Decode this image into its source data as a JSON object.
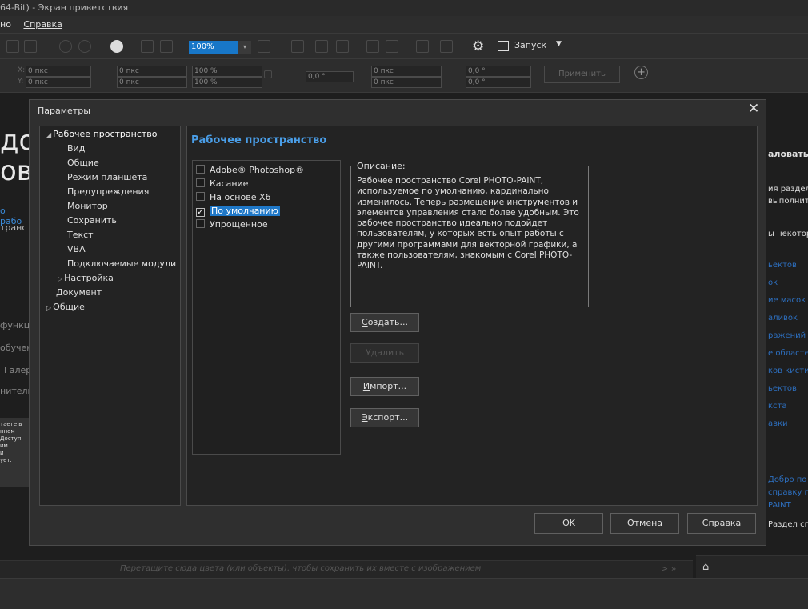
{
  "window": {
    "title": "64-Bit) - Экран приветствия"
  },
  "menu": {
    "items": [
      "но",
      "Справка"
    ]
  },
  "toolbar": {
    "zoom_value": "100%",
    "launch_label": "Запуск",
    "apply_label": "Применить",
    "fields": {
      "x_label": "X:",
      "x_value": "0 пкс",
      "y_label": "Y:",
      "y_value": "0 пкс",
      "w_value": "0 пкс",
      "h_value": "0 пкс",
      "scale_w": "100 %",
      "scale_h": "100 %",
      "angle": "0,0 °",
      "skew_x": "0 пкс",
      "skew_y": "0 пкс",
      "rot_a": "0,0 °",
      "rot_b": "0,0 °"
    }
  },
  "background": {
    "big_text_1": "доб",
    "big_text_2": "ова",
    "link_text": "о рабо",
    "sub_text": "транст",
    "side_items": [
      "функц",
      "обучен",
      "Галер",
      "нитель"
    ],
    "white_box_lines": [
      "таете в",
      "нном",
      "Доступ",
      "им",
      "и",
      "ует."
    ],
    "status_hint": "Перетащите сюда цвета (или объекты), чтобы сохранить их вместе с изображением",
    "status_chevrons": "> »",
    "right_panel": {
      "heading": "аловать",
      "text1": "ия раздел",
      "text2": "выполнит",
      "text3": "ы некотор",
      "links": [
        "ьектов",
        "ок",
        "ие масок",
        "аливок",
        "ражений",
        "е областе",
        "ков кисти",
        "ьектов",
        "кста",
        "авки"
      ],
      "bottom_links": [
        "Добро по",
        "справку п",
        "PAINT"
      ],
      "bottom_text": "Раздел спр"
    }
  },
  "dialog": {
    "title": "Параметры",
    "close_label": "✕",
    "tree": [
      {
        "label": "Рабочее пространство",
        "expanded": true,
        "level": 0
      },
      {
        "label": "Вид",
        "level": 1
      },
      {
        "label": "Общие",
        "level": 1
      },
      {
        "label": "Режим планшета",
        "level": 1
      },
      {
        "label": "Предупреждения",
        "level": 1
      },
      {
        "label": "Монитор",
        "level": 1
      },
      {
        "label": "Сохранить",
        "level": 1
      },
      {
        "label": "Текст",
        "level": 1
      },
      {
        "label": "VBA",
        "level": 1
      },
      {
        "label": "Подключаемые модули",
        "level": 1
      },
      {
        "label": "Настройка",
        "level": 1,
        "collapsed": true
      },
      {
        "label": "Документ",
        "level": 0
      },
      {
        "label": "Общие",
        "level": 0,
        "collapsed": true
      }
    ],
    "section_title": "Рабочее пространство",
    "workspaces": [
      {
        "label": "Adobe® Photoshop®",
        "checked": false,
        "selected": false
      },
      {
        "label": "Касание",
        "checked": false,
        "selected": false
      },
      {
        "label": "На основе X6",
        "checked": false,
        "selected": false
      },
      {
        "label": "По умолчанию",
        "checked": true,
        "selected": true
      },
      {
        "label": "Упрощенное",
        "checked": false,
        "selected": false
      }
    ],
    "description_label": "Описание:",
    "description": "Рабочее пространство Corel PHOTO-PAINT, используемое по умолчанию, кардинально изменилось. Теперь размещение инструментов и элементов управления стало более удобным. Это рабочее пространство идеально подойдет пользователям, у которых есть опыт работы с другими программами для векторной графики, а также пользователям, знакомым с Corel PHOTO-PAINT.",
    "buttons": {
      "create_u": "С",
      "create": "оздать...",
      "delete": "Удалить",
      "import_u": "И",
      "import": "мпорт...",
      "export_u": "Э",
      "export": "кспорт..."
    },
    "footer": {
      "ok": "OK",
      "cancel": "Отмена",
      "help": "Справка"
    }
  },
  "colors": {
    "accent": "#1f78c8",
    "section_title": "#4a9ee8",
    "link": "#2d6fbf"
  }
}
